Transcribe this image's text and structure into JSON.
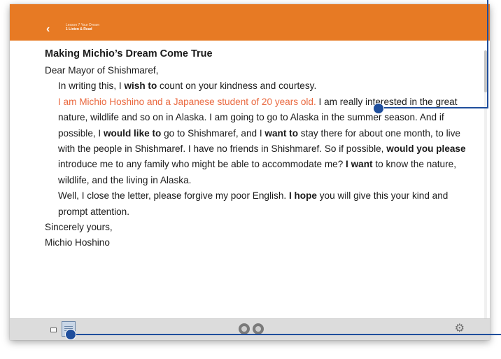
{
  "header": {
    "back_glyph": "‹",
    "crumb_line1": "Lesson 7 Your Dream",
    "crumb_line2": "1 Listen & Read"
  },
  "letter": {
    "title": "Making Michio’s Dream Come True",
    "salutation": "Dear Mayor of Shishmaref,",
    "para1_a": "In writing this, I ",
    "para1_b": "wish to",
    "para1_c": " count on your kindness and courtesy.",
    "para2_highlight": "I am Michio Hoshino and a Japanese student of 20 years old.",
    "para2_a": "  I am really interested in the great nature, wildlife and so on in Alaska.  I am going to go to Alaska in the summer season.  And if possible, I ",
    "para2_b": "would like to",
    "para2_c": " go to Shishmaref, and I ",
    "para2_d": "want to",
    "para2_e": " stay there for about one month, to live with the people in Shishmaref.  I have no friends in Shishmaref.  So if possible, ",
    "para2_f": "would you please",
    "para2_g": " introduce me to any family who might be able to accommodate me?  ",
    "para2_h": "I want",
    "para2_i": " to know the nature, wildlife, and the living in Alaska.",
    "para3_a": "Well, I close the letter, please forgive my poor English.  ",
    "para3_b": "I hope",
    "para3_c": " you will give this your kind and prompt attention.",
    "closing": "Sincerely yours,",
    "signature": "Michio Hoshino"
  },
  "toolbar": {
    "settings_glyph": "⚙"
  },
  "colors": {
    "header_orange": "#e77a24",
    "highlight_text": "#ea6a41",
    "callout_blue": "#1f4e9c"
  },
  "icons": [
    "back-icon",
    "page-toggle-icon",
    "document-icon",
    "play-button-icon",
    "pause-button-icon",
    "settings-gear-icon"
  ]
}
